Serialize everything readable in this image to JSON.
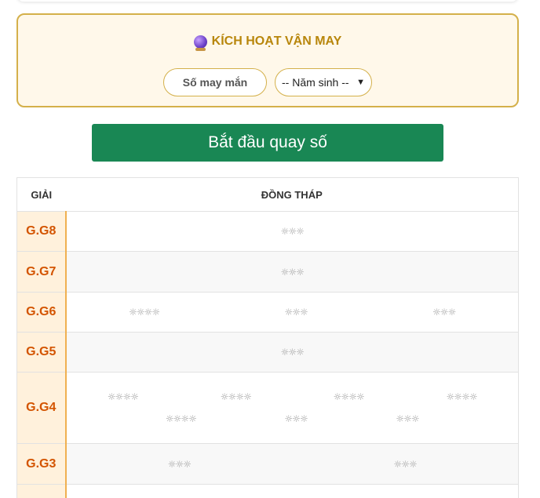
{
  "luck": {
    "title": "KÍCH HOẠT VẬN MAY",
    "lucky_placeholder": "Số may mắn",
    "year_selected": "-- Năm sinh --"
  },
  "spin_label": "Bắt đầu quay số",
  "table": {
    "col_prize": "GIẢI",
    "col_province": "ĐỒNG THÁP",
    "spinner": "☼☼☼",
    "spinner4": "☼☼☼☼",
    "rows": [
      {
        "prize": "G.G8"
      },
      {
        "prize": "G.G7"
      },
      {
        "prize": "G.G6"
      },
      {
        "prize": "G.G5"
      },
      {
        "prize": "G.G4"
      },
      {
        "prize": "G.G3"
      }
    ]
  },
  "colors": {
    "accent_green": "#198754",
    "gold": "#b8860b",
    "prize_orange": "#d35400"
  }
}
